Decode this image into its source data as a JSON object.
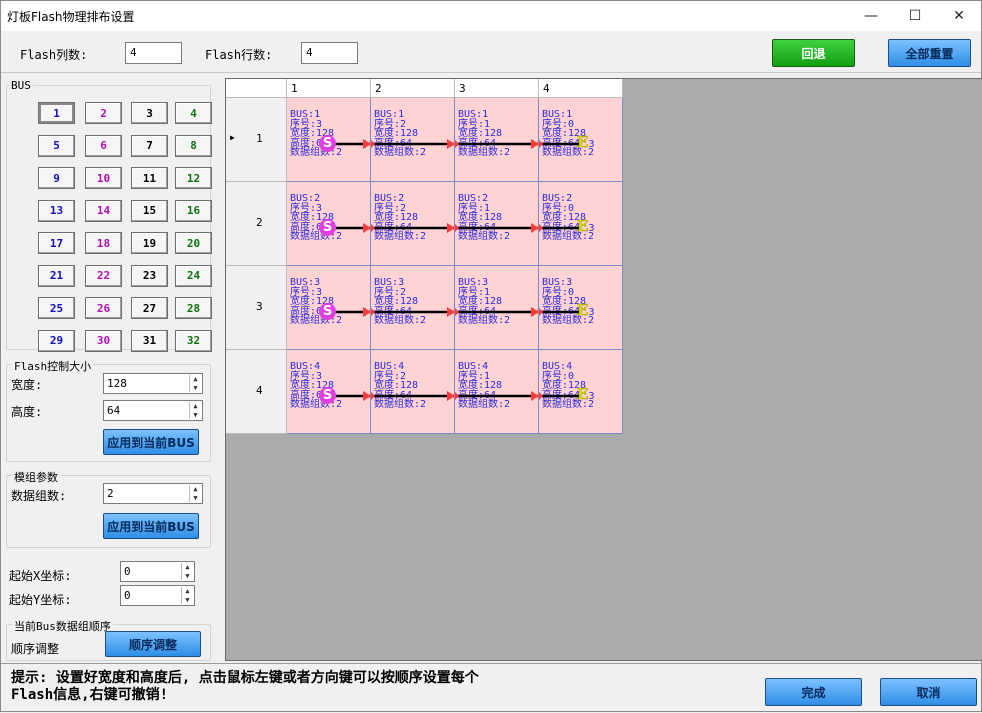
{
  "window": {
    "title": "灯板Flash物理排布设置"
  },
  "top": {
    "cols_label": "Flash列数:",
    "cols_value": "4",
    "rows_label": "Flash行数:",
    "rows_value": "4",
    "back_label": "回退",
    "reset_label": "全部重置"
  },
  "bus": {
    "title": "BUS",
    "buttons": [
      "1",
      "2",
      "3",
      "4",
      "5",
      "6",
      "7",
      "8",
      "9",
      "10",
      "11",
      "12",
      "13",
      "14",
      "15",
      "16",
      "17",
      "18",
      "19",
      "20",
      "21",
      "22",
      "23",
      "24",
      "25",
      "26",
      "27",
      "28",
      "29",
      "30",
      "31",
      "32"
    ],
    "selected": "1"
  },
  "flash_size": {
    "title": "Flash控制大小",
    "width_label": "宽度:",
    "width_value": "128",
    "height_label": "高度:",
    "height_value": "64",
    "apply_label": "应用到当前BUS"
  },
  "module": {
    "title": "模组参数",
    "groups_label": "数据组数:",
    "groups_value": "2",
    "apply_label": "应用到当前BUS"
  },
  "start": {
    "x_label": "起始X坐标:",
    "x_value": "0",
    "y_label": "起始Y坐标:",
    "y_value": "0"
  },
  "order": {
    "title": "当前Bus数据组顺序",
    "adjust_label": "顺序调整",
    "adjust_button": "顺序调整"
  },
  "grid": {
    "col_headers": [
      "1",
      "2",
      "3",
      "4"
    ],
    "row_headers": [
      "1",
      "2",
      "3",
      "4"
    ],
    "cell_labels": {
      "bus": "BUS:",
      "seq": "序号:",
      "width": "宽度:",
      "height": "高度:",
      "groups": "数据组数:"
    },
    "width_value": "128",
    "height_value": "64",
    "groups_value": "2",
    "seq_per_col": [
      "3",
      "2",
      "1",
      "0"
    ],
    "start_marker": "S",
    "end_marker": "E",
    "end_suffix": "3"
  },
  "bottom": {
    "hint_line1": "提示: 设置好宽度和高度后, 点击鼠标左键或者方向键可以按顺序设置每个",
    "hint_line2": "Flash信息,右键可撤销!",
    "done_label": "完成",
    "cancel_label": "取消"
  },
  "colors": {
    "cell_bg": "#ffd3d3",
    "cell_text": "#2b2bd8",
    "arrow": "#ff3b3b",
    "start_marker": "#e040e0",
    "end_marker": "#e0e000",
    "grid_bg": "#ababab"
  }
}
